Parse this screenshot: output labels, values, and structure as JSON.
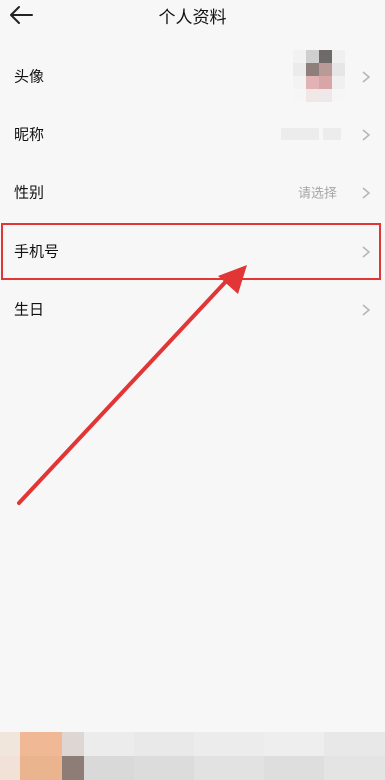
{
  "header": {
    "title": "个人资料",
    "back_icon": "back-arrow-icon"
  },
  "rows": [
    {
      "label": "头像",
      "value": ""
    },
    {
      "label": "昵称",
      "value": ""
    },
    {
      "label": "性别",
      "value": "请选择"
    },
    {
      "label": "手机号",
      "value": ""
    },
    {
      "label": "生日",
      "value": ""
    }
  ],
  "annotation": {
    "highlight_color": "#e23535",
    "highlighted_row": "手机号"
  },
  "colors": {
    "background": "#f7f7f7",
    "text": "#111111",
    "secondary_text": "#a6a6a6",
    "chevron": "#b5b5b5",
    "annotation": "#e23535"
  }
}
